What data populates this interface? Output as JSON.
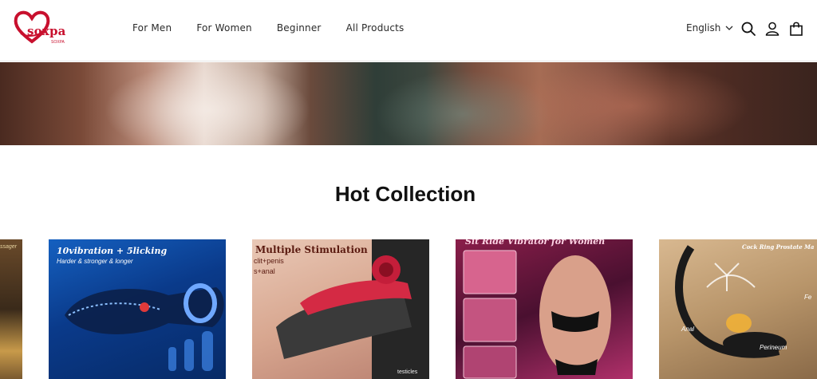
{
  "brand": {
    "logo_text": "soxpa",
    "logo_subtext": "SOXPA",
    "accent_color": "#c8102e"
  },
  "nav": {
    "items": [
      {
        "label": "For Men"
      },
      {
        "label": "For Women"
      },
      {
        "label": "Beginner"
      },
      {
        "label": "All Products"
      }
    ]
  },
  "header": {
    "language": "English",
    "icons": [
      "search-icon",
      "account-icon",
      "cart-icon"
    ]
  },
  "hero": {
    "image": "blurred-lifestyle-photo"
  },
  "collection": {
    "title": "Hot Collection",
    "cards": [
      {
        "title": "",
        "subtitle": "ssager"
      },
      {
        "title": "10vibration + 5licking",
        "subtitle": "Harder & stronger & longer"
      },
      {
        "title": "Multiple Stimulation",
        "lines": [
          "clit+penis",
          "s+anal",
          "testicles"
        ]
      },
      {
        "title": "Sit Ride Vibrator for Women",
        "subtitle": ""
      },
      {
        "title": "Cock Ring Prostate Ma",
        "lines": [
          "Anal",
          "Perineum",
          "Fe"
        ]
      }
    ]
  }
}
